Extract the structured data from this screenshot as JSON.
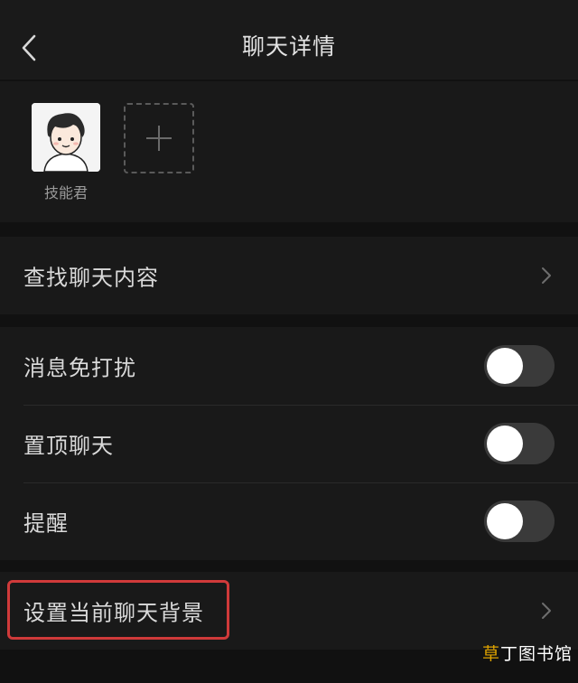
{
  "header": {
    "title": "聊天详情",
    "back_icon": "chevron-left-icon"
  },
  "members": {
    "items": [
      {
        "name": "技能君",
        "avatar": "cartoon-boy-avatar"
      }
    ],
    "add_icon": "plus-icon"
  },
  "search_section": {
    "label": "查找聊天内容",
    "icon": "chevron-right-icon"
  },
  "toggles": [
    {
      "label": "消息免打扰",
      "state": "off"
    },
    {
      "label": "置顶聊天",
      "state": "off"
    },
    {
      "label": "提醒",
      "state": "off"
    }
  ],
  "background_section": {
    "label": "设置当前聊天背景",
    "icon": "chevron-right-icon"
  },
  "watermark": {
    "accent": "草",
    "rest": "丁图书馆"
  },
  "colors": {
    "background": "#111111",
    "surface": "#191919",
    "toggle_off": "#3a3a3a",
    "highlight": "#d03a3a",
    "watermark_accent": "#e0a400"
  }
}
